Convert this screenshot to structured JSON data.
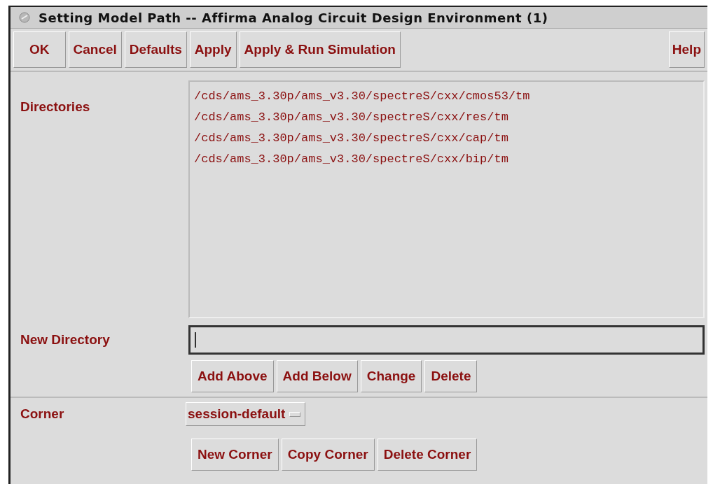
{
  "window": {
    "title": "Setting Model Path -- Affirma Analog Circuit Design Environment (1)"
  },
  "toolbar": {
    "buttons": [
      "OK",
      "Cancel",
      "Defaults",
      "Apply",
      "Apply & Run Simulation"
    ],
    "help": "Help"
  },
  "directories": {
    "label": "Directories",
    "items": [
      "/cds/ams_3.30p/ams_v3.30/spectreS/cxx/cmos53/tm",
      "/cds/ams_3.30p/ams_v3.30/spectreS/cxx/res/tm",
      "/cds/ams_3.30p/ams_v3.30/spectreS/cxx/cap/tm",
      "/cds/ams_3.30p/ams_v3.30/spectreS/cxx/bip/tm"
    ]
  },
  "new_directory": {
    "label": "New Directory",
    "buttons": [
      "Add Above",
      "Add Below",
      "Change",
      "Delete"
    ]
  },
  "corner": {
    "label": "Corner",
    "value": "session-default",
    "buttons": [
      "New Corner",
      "Copy Corner",
      "Delete Corner"
    ]
  }
}
